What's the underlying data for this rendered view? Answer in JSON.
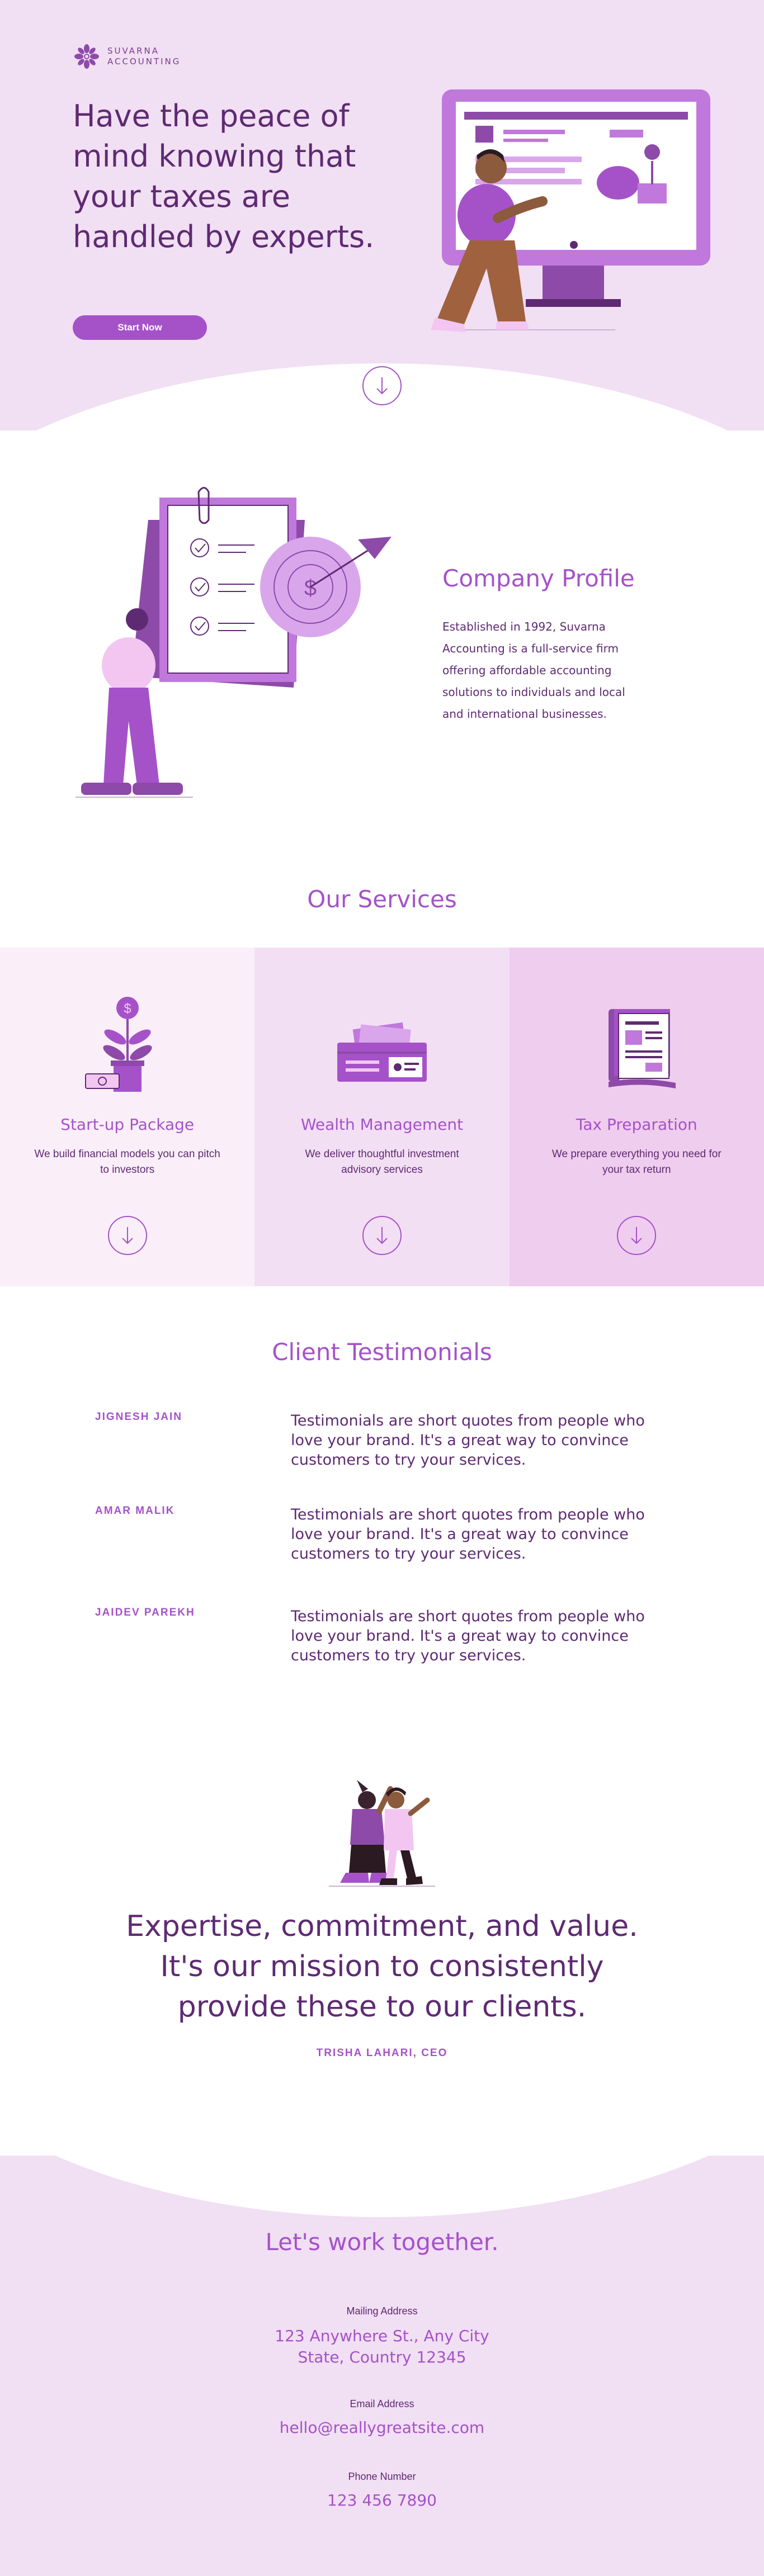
{
  "brand": {
    "name_line1": "SUVARNA",
    "name_line2": "ACCOUNTING",
    "colors": {
      "primary": "#a552c9",
      "dark": "#5e2a72",
      "light_bg": "#f1dff3",
      "pale_bg": "#faeff9",
      "mid_bg": "#f3dff4",
      "deep_bg": "#efcdee"
    }
  },
  "hero": {
    "title": "Have the peace of mind knowing that your taxes are handled by experts.",
    "button_label": "Start Now",
    "scroll_icon": "arrow-down-circle-icon"
  },
  "profile": {
    "title": "Company Profile",
    "text": "Established in 1992, Suvarna Accounting is a full-service firm offering affordable accounting solutions to individuals and local and international businesses."
  },
  "services": {
    "title": "Our Services",
    "items": [
      {
        "name": "Start-up Package",
        "description": "We build financial models you can pitch to investors",
        "icon": "money-plant-icon"
      },
      {
        "name": "Wealth Management",
        "description": "We deliver thoughtful investment advisory services",
        "icon": "wallet-icon"
      },
      {
        "name": "Tax Preparation",
        "description": "We prepare everything you need for your tax return",
        "icon": "tax-document-icon"
      }
    ]
  },
  "testimonials": {
    "title": "Client Testimonials",
    "items": [
      {
        "name": "JIGNESH JAIN",
        "quote": "Testimonials are short quotes from people who love your brand. It's a great way to convince customers to try your services."
      },
      {
        "name": "AMAR MALIK",
        "quote": "Testimonials are short quotes from people who love your brand. It's a great way to convince customers to try your services."
      },
      {
        "name": "JAIDEV PAREKH",
        "quote": "Testimonials are short quotes from people who love your brand. It's a great way to convince customers to try your services."
      }
    ]
  },
  "mission": {
    "quote": "Expertise, commitment, and value. It's our mission to consistently provide these to our clients.",
    "author": "TRISHA LAHARI, CEO"
  },
  "contact": {
    "title": "Let's work together.",
    "mailing_label": "Mailing Address",
    "mailing_line1": "123 Anywhere St., Any City",
    "mailing_line2": "State, Country 12345",
    "email_label": "Email Address",
    "email_value": "hello@reallygreatsite.com",
    "phone_label": "Phone Number",
    "phone_value": "123 456 7890"
  }
}
